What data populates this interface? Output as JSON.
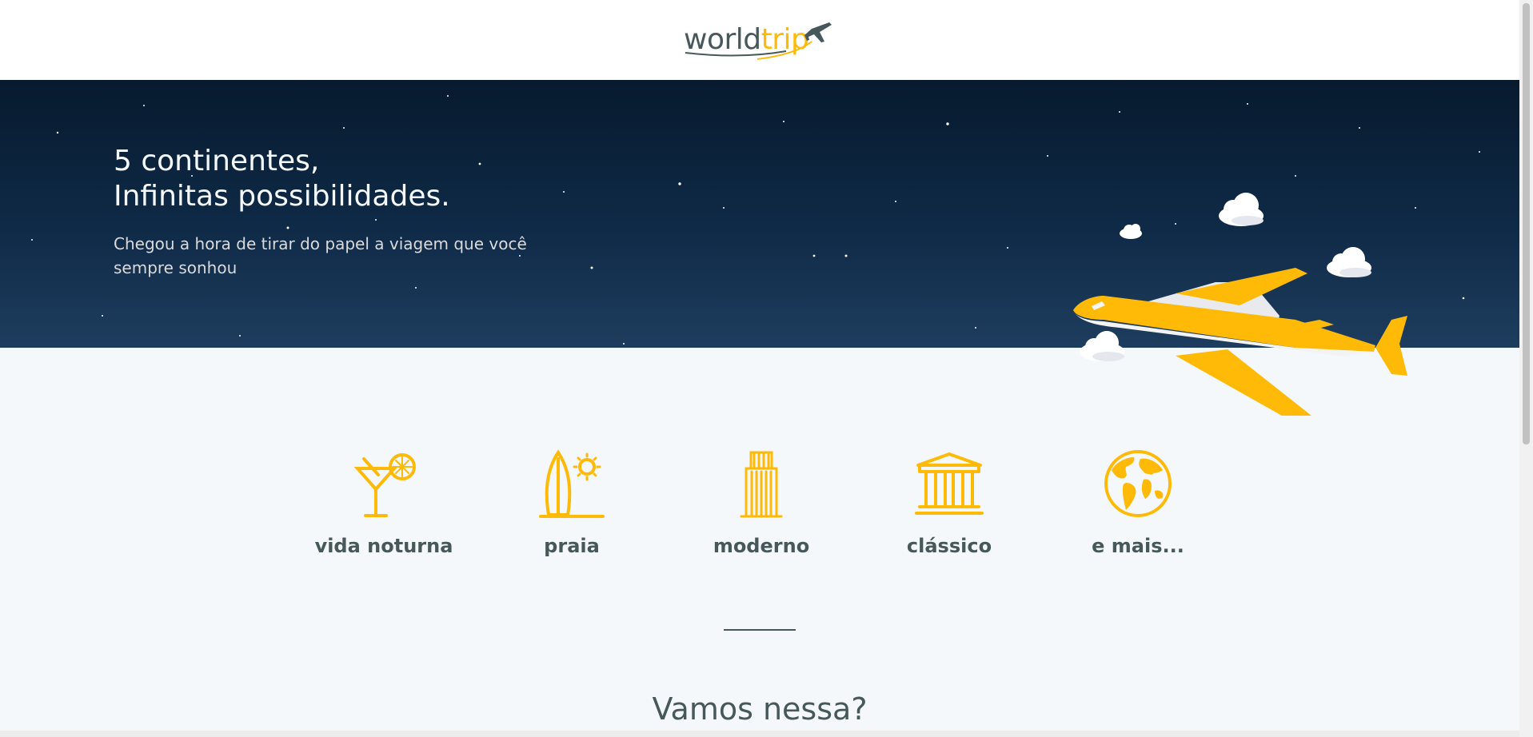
{
  "header": {
    "logo": {
      "part1": "world",
      "part2": "trip"
    }
  },
  "banner": {
    "title_line1": "5 continentes,",
    "title_line2": "Infinitas possibilidades.",
    "subtitle": "Chegou a hora de tirar do papel a viagem que você sempre sonhou"
  },
  "travel_types": [
    {
      "label": "vida noturna",
      "icon": "cocktail-icon"
    },
    {
      "label": "praia",
      "icon": "surf-beach-icon"
    },
    {
      "label": "moderno",
      "icon": "skyscraper-icon"
    },
    {
      "label": "clássico",
      "icon": "museum-icon"
    },
    {
      "label": "e mais...",
      "icon": "globe-icon"
    }
  ],
  "cta": {
    "text": "Vamos nessa?"
  },
  "colors": {
    "accent": "#ffba08",
    "text_dark": "#47585b",
    "banner_dark": "#071a2e",
    "background": "#f5f8fa"
  }
}
